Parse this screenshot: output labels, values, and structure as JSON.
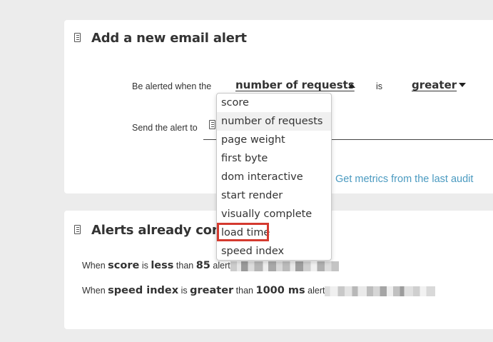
{
  "add_card": {
    "title": "Add a new email alert",
    "be_alerted_label": "Be alerted when the",
    "metric_selected": "number of requests",
    "is_label": "is",
    "comparator_selected": "greater",
    "send_alert_label": "Send the alert to",
    "get_metrics_link": "Get metrics from the last audit"
  },
  "dropdown": {
    "items": [
      "score",
      "number of requests",
      "page weight",
      "first byte",
      "dom interactive",
      "start render",
      "visually complete",
      "load time",
      "speed index"
    ],
    "selected_index": 1,
    "highlighted_index": 7,
    "highlight_color": "#d43a2f"
  },
  "existing_card": {
    "title": "Alerts already confi",
    "alerts": [
      {
        "when": "When",
        "metric": "score",
        "is": "is",
        "comparator": "less",
        "than": "than",
        "value": "85",
        "alert": "alert"
      },
      {
        "when": "When",
        "metric": "speed index",
        "is": "is",
        "comparator": "greater",
        "than": "than",
        "value": "1000 ms",
        "alert": "alert"
      }
    ]
  },
  "colors": {
    "background": "#ececec",
    "card": "#ffffff",
    "link": "#4a9ac0"
  }
}
